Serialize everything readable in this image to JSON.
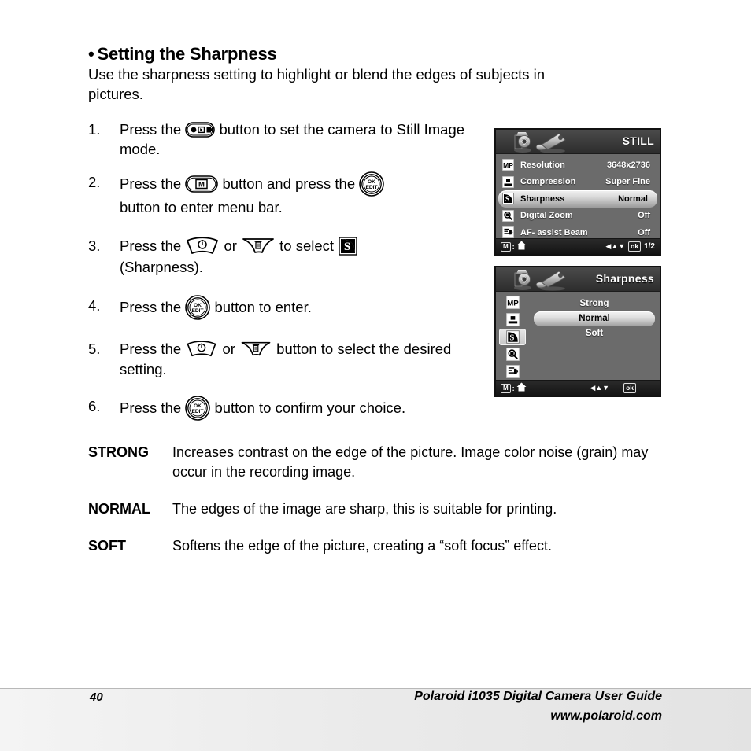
{
  "heading": {
    "bullet": "•",
    "text": "Setting the Sharpness"
  },
  "intro": {
    "line1": "Use the sharpness setting to highlight or blend the edges of subjects in",
    "line2": "pictures."
  },
  "steps": [
    {
      "num": "1.",
      "pre": "Press the",
      "icon": "mode-button-icon",
      "post": "button to set the camera to Still Image mode."
    },
    {
      "num": "2.",
      "pre": "Press the",
      "icon": "menu-button-icon",
      "mid": "button and press the",
      "icon2": "ok-edit-button-icon",
      "post": "button to enter menu bar."
    },
    {
      "num": "3.",
      "pre": "Press the",
      "icon": "up-self-timer-button-icon",
      "mid": "or",
      "icon2": "down-delete-button-icon",
      "mid2": "to select",
      "icon3": "sharpness-icon",
      "post": "(Sharpness)."
    },
    {
      "num": "4.",
      "pre": "Press the",
      "icon": "ok-edit-button-icon",
      "post": "button to enter."
    },
    {
      "num": "5.",
      "pre": "Press the",
      "icon": "up-self-timer-button-icon",
      "mid": "or",
      "icon2": "down-delete-button-icon",
      "post": "button to select the desired setting."
    },
    {
      "num": "6.",
      "pre": "Press the",
      "icon": "ok-edit-button-icon",
      "post": "button to confirm your choice."
    }
  ],
  "lcd_still": {
    "title": "STILL",
    "rows": [
      {
        "icon": "mp-resolution-icon",
        "label": "Resolution",
        "value": "3648x2736",
        "selected": false
      },
      {
        "icon": "compression-icon",
        "label": "Compression",
        "value": "Super Fine",
        "selected": false
      },
      {
        "icon": "sharpness-icon",
        "label": "Sharpness",
        "value": "Normal",
        "selected": true
      },
      {
        "icon": "digital-zoom-icon",
        "label": "Digital Zoom",
        "value": "Off",
        "selected": false
      },
      {
        "icon": "af-assist-icon",
        "label": "AF- assist Beam",
        "value": "Off",
        "selected": false
      }
    ],
    "status": {
      "menu_key": "M",
      "colon": ":",
      "home_icon": "home-icon",
      "arrows": "◀▲▼",
      "ok": "ok",
      "page": "1/2"
    }
  },
  "lcd_sharpness": {
    "title": "Sharpness",
    "side_icons": [
      {
        "icon": "mp-resolution-icon",
        "active": false
      },
      {
        "icon": "compression-icon",
        "active": false
      },
      {
        "icon": "sharpness-icon",
        "active": true
      },
      {
        "icon": "digital-zoom-icon",
        "active": false
      },
      {
        "icon": "af-assist-icon",
        "active": false
      }
    ],
    "options": [
      {
        "label": "Strong",
        "selected": false
      },
      {
        "label": "Normal",
        "selected": true
      },
      {
        "label": "Soft",
        "selected": false
      }
    ],
    "status": {
      "menu_key": "M",
      "colon": ":",
      "home_icon": "home-icon",
      "arrows": "◀▲▼",
      "ok": "ok"
    }
  },
  "definitions": [
    {
      "term": "STRONG",
      "text": "Increases contrast on the edge of the picture. Image color noise (grain) may occur in the recording image."
    },
    {
      "term": "NORMAL",
      "text": "The edges of the image are sharp, this is suitable for printing."
    },
    {
      "term": "SOFT",
      "text": "Softens the edge of the picture, creating a “soft focus” effect."
    }
  ],
  "footer": {
    "page_number": "40",
    "guide": "Polaroid i1035 Digital Camera User Guide",
    "url": "www.polaroid.com"
  }
}
